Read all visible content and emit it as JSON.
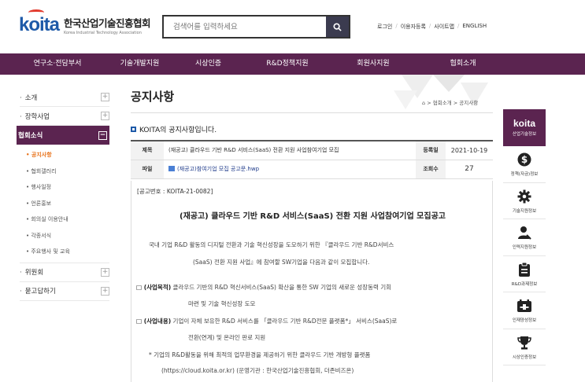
{
  "header": {
    "logo_mark": "koita",
    "logo_korean": "한국산업기술진흥협회",
    "logo_english": "Korea Industrial Technology Association",
    "search_placeholder": "검색어를 입력하세요",
    "util_links": [
      "로그인",
      "이용자등록",
      "사이트맵",
      "ENGLISH"
    ]
  },
  "gnb": [
    "연구소·전담부서",
    "기술개발지원",
    "시상인증",
    "R&D정책지원",
    "회원사지원",
    "협회소개"
  ],
  "lnb": {
    "items_top": [
      "소개",
      "장학사업"
    ],
    "active": "협회소식",
    "sub_items": [
      "공지사항",
      "협회갤러리",
      "행사일정",
      "언론홍보",
      "회의실 이용안내",
      "각종서식",
      "주요행사 및 교육"
    ],
    "items_bottom": [
      "위원회",
      "묻고답하기"
    ]
  },
  "page": {
    "title": "공지사항",
    "breadcrumb": [
      "협회소개",
      "공지사항"
    ],
    "subheading": "KOITA의 공지사항입니다."
  },
  "notice": {
    "title_label": "제목",
    "title": "(재공고) 클라우드 기반 R&D 서비스(SaaS) 전환 지원 사업참여기업 모집",
    "date_label": "등록일",
    "date": "2021-10-19",
    "file_label": "파일",
    "file": "(재공고)참여기업 모집 공고문.hwp",
    "views_label": "조회수",
    "views": "27",
    "number": "[공고번호 : KOITA-21-0082]",
    "heading": "(재공고) 클라우드 기반 R&D 서비스(SaaS) 전환 지원 사업참여기업 모집공고",
    "intro_1": "국내 기업 R&D 활동의 디지털 전환과 기술 혁신성장을 도모하기 위한 『클라우드 기반 R&D서비스",
    "intro_2": "(SaaS) 전환 지원 사업』에 참여할 SW기업을 다음과 같이 모집합니다.",
    "purpose_label": "□ (사업목적)",
    "purpose_1": "클라우드 기반의 R&D 혁신서비스(SaaS) 확산을 통한 SW 기업의 새로운 성장동력 기회",
    "purpose_2": "마련 및 기술 혁신성장 도모",
    "content_label": "□ (사업내용)",
    "content_1": "기업이 자체 보유한 R&D 서비스를 「클라우드 기반 R&D전문 플랫폼*」 서비스(SaaS)로",
    "content_2": "전환(연계) 및 온라인 판로 지원",
    "note_1": "* 기업의 R&D활동을 위해 최적의 업무환경을 제공하기 위한 클라우드 기반 개방형 플랫폼",
    "note_2": "(https://cloud.koita.or.kr) (운영기관 : 한국산업기술진흥협회, 더존비즈온)"
  },
  "quick": {
    "logo": "koita",
    "head_label": "산업기술정보",
    "items": [
      {
        "icon": "dollar-icon",
        "label": "정책(자금)정보"
      },
      {
        "icon": "gear-icon",
        "label": "기술지원정보"
      },
      {
        "icon": "user-icon",
        "label": "인력지원정보"
      },
      {
        "icon": "clipboard-icon",
        "label": "R&D과제정보"
      },
      {
        "icon": "calendar-icon",
        "label": "인재양성정보"
      },
      {
        "icon": "trophy-icon",
        "label": "시상인증정보"
      }
    ]
  },
  "colors": {
    "brand_purple": "#5b2450",
    "brand_blue": "#1e5aa8",
    "brand_red": "#e23b2e",
    "active_orange": "#e8731c"
  }
}
